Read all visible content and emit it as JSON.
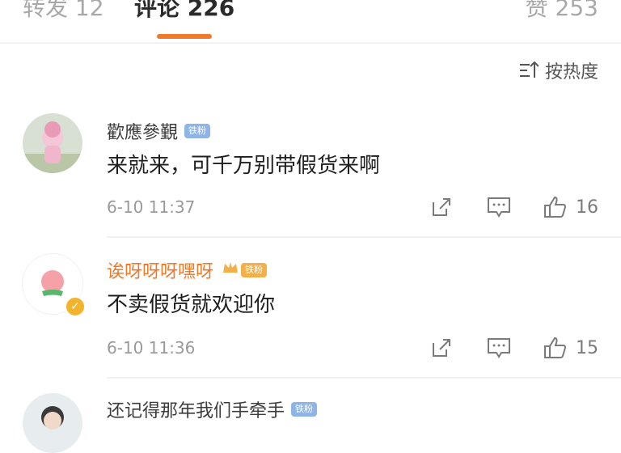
{
  "tabs": [
    {
      "label": "转发 12"
    },
    {
      "label": "评论 226"
    },
    {
      "label": "赞 253"
    }
  ],
  "sort": {
    "label": "按热度",
    "icon": "sort-icon"
  },
  "badges": {
    "iron_fan": "铁粉"
  },
  "comments": [
    {
      "username": "歡應參覲",
      "text": "来就来，可千万别带假货来啊",
      "time": "6-10 11:37",
      "likes": "16"
    },
    {
      "username": "诶呀呀呀嘿呀",
      "text": "不卖假货就欢迎你",
      "time": "6-10 11:36",
      "likes": "15"
    },
    {
      "username": "还记得那年我们手牵手",
      "text": "",
      "time": "",
      "likes": ""
    }
  ],
  "colors": {
    "accent": "#f07a2c",
    "vip_name": "#f07a2c",
    "badge_blue": "#8fb4e8",
    "badge_orange": "#f3b04a"
  }
}
